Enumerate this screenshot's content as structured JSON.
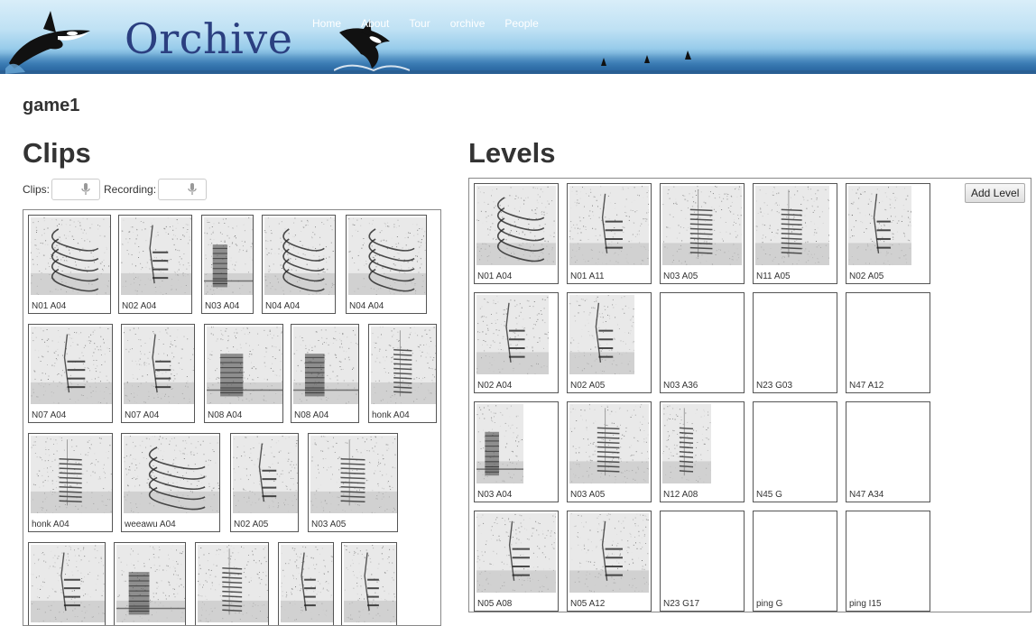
{
  "header": {
    "brand": "Orchive",
    "nav": [
      "Home",
      "About",
      "Tour",
      "orchive",
      "People"
    ]
  },
  "page": {
    "game_title": "game1",
    "clips_heading": "Clips",
    "levels_heading": "Levels"
  },
  "controls": {
    "clips_label": "Clips:",
    "recording_label": "Recording:"
  },
  "add_level_label": "Add Level",
  "clips": [
    {
      "label": "N01 A04",
      "pattern": "arcs"
    },
    {
      "label": "N02 A04",
      "pattern": "stairs"
    },
    {
      "label": "N03 A04",
      "pattern": "band"
    },
    {
      "label": "N04 A04",
      "pattern": "arcs"
    },
    {
      "label": "N04 A04",
      "pattern": "arcs"
    },
    {
      "label": "N07 A04",
      "pattern": "stairs"
    },
    {
      "label": "N07 A04",
      "pattern": "stairs"
    },
    {
      "label": "N08 A04",
      "pattern": "band"
    },
    {
      "label": "N08 A04",
      "pattern": "band"
    },
    {
      "label": "honk A04",
      "pattern": "bars"
    },
    {
      "label": "honk A04",
      "pattern": "bars"
    },
    {
      "label": "weeawu A04",
      "pattern": "arcs"
    },
    {
      "label": "N02 A05",
      "pattern": "stairs"
    },
    {
      "label": "N03 A05",
      "pattern": "bars"
    },
    {
      "label": "",
      "pattern": "stairs"
    },
    {
      "label": "",
      "pattern": "band"
    },
    {
      "label": "",
      "pattern": "bars"
    },
    {
      "label": "",
      "pattern": "stairs"
    },
    {
      "label": "",
      "pattern": "stairs"
    }
  ],
  "levels": [
    {
      "label": "N01 A04",
      "pattern": "arcs"
    },
    {
      "label": "N01 A11",
      "pattern": "stairs"
    },
    {
      "label": "N03 A05",
      "pattern": "bars"
    },
    {
      "label": "N11 A05",
      "pattern": "bars"
    },
    {
      "label": "N02 A05",
      "pattern": "stairs"
    },
    {
      "label": "N02 A04",
      "pattern": "stairs"
    },
    {
      "label": "N02 A05",
      "pattern": "stairs"
    },
    {
      "label": "N03 A36",
      "pattern": "none"
    },
    {
      "label": "N23 G03",
      "pattern": "none"
    },
    {
      "label": "N47 A12",
      "pattern": "none"
    },
    {
      "label": "N03 A04",
      "pattern": "band"
    },
    {
      "label": "N03 A05",
      "pattern": "bars"
    },
    {
      "label": "N12 A08",
      "pattern": "bars"
    },
    {
      "label": "N45 G",
      "pattern": "none"
    },
    {
      "label": "N47 A34",
      "pattern": "none"
    },
    {
      "label": "N05 A08",
      "pattern": "stairs"
    },
    {
      "label": "N05 A12",
      "pattern": "stairs"
    },
    {
      "label": "N23 G17",
      "pattern": "none"
    },
    {
      "label": "ping G",
      "pattern": "none"
    },
    {
      "label": "ping I15",
      "pattern": "none"
    }
  ]
}
